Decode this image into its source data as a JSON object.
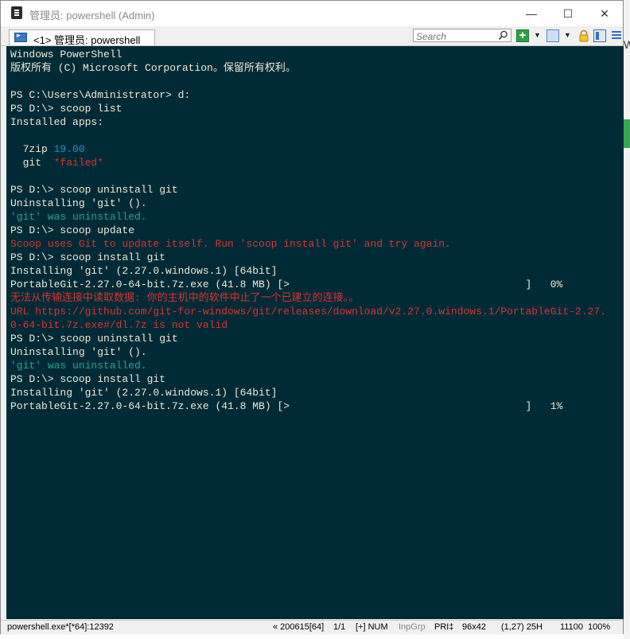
{
  "window": {
    "title": "管理员: powershell (Admin)",
    "minimize": "—",
    "maximize": "☐",
    "close": "✕"
  },
  "toolbar": {
    "tab_label": "<1> 管理员: powershell",
    "search_placeholder": "Search",
    "dropdown_arrow": "▼",
    "icons": [
      "plus-icon",
      "window-icon",
      "lock-icon",
      "panel-icon",
      "menu-icon"
    ]
  },
  "console": {
    "colors": {
      "background": "#002b36",
      "foreground": "#eee8d5",
      "blue": "#268bd2",
      "red": "#dc322f",
      "cyan": "#2aa198"
    },
    "lines": [
      [
        {
          "t": "Windows PowerShell"
        }
      ],
      [
        {
          "t": "版权所有 (C) Microsoft Corporation。保留所有权利。"
        }
      ],
      [
        {
          "t": ""
        }
      ],
      [
        {
          "t": "PS C:\\Users\\Administrator> d:"
        }
      ],
      [
        {
          "t": "PS D:\\> scoop list"
        }
      ],
      [
        {
          "t": "Installed apps:"
        }
      ],
      [
        {
          "t": ""
        }
      ],
      [
        {
          "t": "  7zip "
        },
        {
          "t": "19.00",
          "c": "blue"
        }
      ],
      [
        {
          "t": "  git  "
        },
        {
          "t": "*failed*",
          "c": "red"
        }
      ],
      [
        {
          "t": ""
        }
      ],
      [
        {
          "t": "PS D:\\> scoop uninstall git"
        }
      ],
      [
        {
          "t": "Uninstalling 'git' ()."
        }
      ],
      [
        {
          "t": "'git' was uninstalled.",
          "c": "cyan"
        }
      ],
      [
        {
          "t": "PS D:\\> scoop update"
        }
      ],
      [
        {
          "t": "Scoop uses Git to update itself. Run 'scoop install git' and try again.",
          "c": "red"
        }
      ],
      [
        {
          "t": "PS D:\\> scoop install git"
        }
      ],
      [
        {
          "t": "Installing 'git' (2.27.0.windows.1) [64bit]"
        }
      ],
      [
        {
          "t": "PortableGit-2.27.0-64-bit.7z.exe (41.8 MB) [>                                      ]   0%"
        }
      ],
      [
        {
          "t": "无法从传输连接中读取数据: 你的主机中的软件中止了一个已建立的连接。。",
          "c": "red"
        }
      ],
      [
        {
          "t": "URL https://github.com/git-for-windows/git/releases/download/v2.27.0.windows.1/PortableGit-2.27.",
          "c": "red"
        }
      ],
      [
        {
          "t": "0-64-bit.7z.exe#/dl.7z is not valid",
          "c": "red"
        }
      ],
      [
        {
          "t": "PS D:\\> scoop uninstall git"
        }
      ],
      [
        {
          "t": "Uninstalling 'git' ()."
        }
      ],
      [
        {
          "t": "'git' was uninstalled.",
          "c": "cyan"
        }
      ],
      [
        {
          "t": "PS D:\\> scoop install git"
        }
      ],
      [
        {
          "t": "Installing 'git' (2.27.0.windows.1) [64bit]"
        }
      ],
      [
        {
          "t": "PortableGit-2.27.0-64-bit.7z.exe (41.8 MB) [>                                      ]   1%"
        }
      ]
    ]
  },
  "statusbar": {
    "process": "powershell.exe*[*64]:12392",
    "build": "« 200615[64]",
    "pages": "1/1",
    "keys": "[+] NUM",
    "inpgrp": "InpGrp",
    "pri": "PRI‡",
    "size": "96x42",
    "cursor": "(1,27) 25H",
    "pid": "11100",
    "zoom": "100%"
  },
  "background": {
    "text": "W"
  }
}
